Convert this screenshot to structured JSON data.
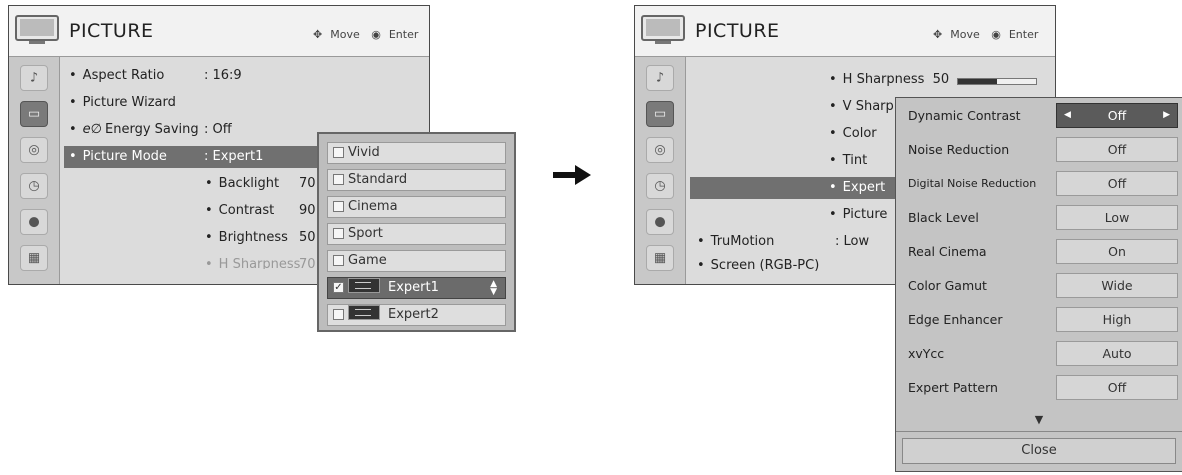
{
  "left": {
    "title": "PICTURE",
    "hint_move": "Move",
    "hint_enter": "Enter",
    "menu": {
      "aspect_ratio_label": "Aspect Ratio",
      "aspect_ratio_value": ": 16:9",
      "picture_wizard_label": "Picture Wizard",
      "energy_saving_label": "Energy Saving",
      "energy_saving_value": ": Off",
      "picture_mode_label": "Picture Mode",
      "picture_mode_value": ": Expert1",
      "backlight_label": "Backlight",
      "backlight_value": "70",
      "contrast_label": "Contrast",
      "contrast_value": "90",
      "brightness_label": "Brightness",
      "brightness_value": "50",
      "h_sharpness_label": "H Sharpness",
      "h_sharpness_value": "70"
    },
    "mode_options": [
      "Vivid",
      "Standard",
      "Cinema",
      "Sport",
      "Game",
      "Expert1",
      "Expert2"
    ],
    "selected_mode": "Expert1"
  },
  "right": {
    "title": "PICTURE",
    "hint_move": "Move",
    "hint_enter": "Enter",
    "menu": {
      "h_sharpness_label": "H Sharpness",
      "h_sharpness_value": "50",
      "h_sharpness_level": 0.5,
      "v_sharpness_label": "V Sharp",
      "color_label": "Color",
      "tint_label": "Tint",
      "expert_label": "Expert",
      "picture_label": "Picture",
      "trumotion_label": "TruMotion",
      "trumotion_value": ": Low",
      "screen_label": "Screen (RGB-PC)"
    },
    "expert_settings": [
      {
        "label": "Dynamic Contrast",
        "value": "Off"
      },
      {
        "label": "Noise Reduction",
        "value": "Off"
      },
      {
        "label": "Digital Noise Reduction",
        "value": "Off"
      },
      {
        "label": "Black Level",
        "value": "Low"
      },
      {
        "label": "Real Cinema",
        "value": "On"
      },
      {
        "label": "Color Gamut",
        "value": "Wide"
      },
      {
        "label": "Edge Enhancer",
        "value": "High"
      },
      {
        "label": "xvYcc",
        "value": "Auto"
      },
      {
        "label": "Expert Pattern",
        "value": "Off"
      }
    ],
    "close_label": "Close"
  },
  "icons": {
    "transition_arrow": "right-arrow-icon",
    "tv": "tv-icon",
    "move": "move-icon",
    "enter": "enter-icon"
  }
}
